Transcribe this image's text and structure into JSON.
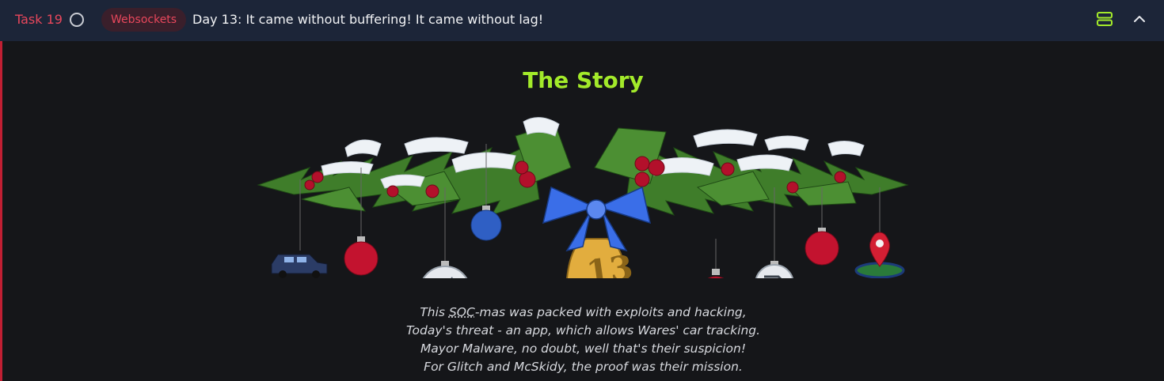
{
  "header": {
    "task_label": "Task 19",
    "tag": "Websockets",
    "title": "Day 13: It came without buffering! It came without lag!",
    "icons": [
      "status-circle-icon",
      "server-icon",
      "chevron-up-icon"
    ],
    "colors": {
      "accent_red": "#e8475c",
      "accent_green": "#a3ea2a",
      "header_bg": "#1c2538"
    }
  },
  "content": {
    "heading": "The Story",
    "bell_number": "13",
    "poem": {
      "line1_prefix": "This ",
      "line1_abbr": "SOC",
      "line1_suffix": "-mas was packed with exploits and hacking,",
      "line2": "Today's threat - an app, which allows Wares' car tracking.",
      "line3": "Mayor Malware, no doubt, well that's their suspicion!",
      "line4": "For Glitch and McSkidy, the proof was their mission."
    }
  }
}
